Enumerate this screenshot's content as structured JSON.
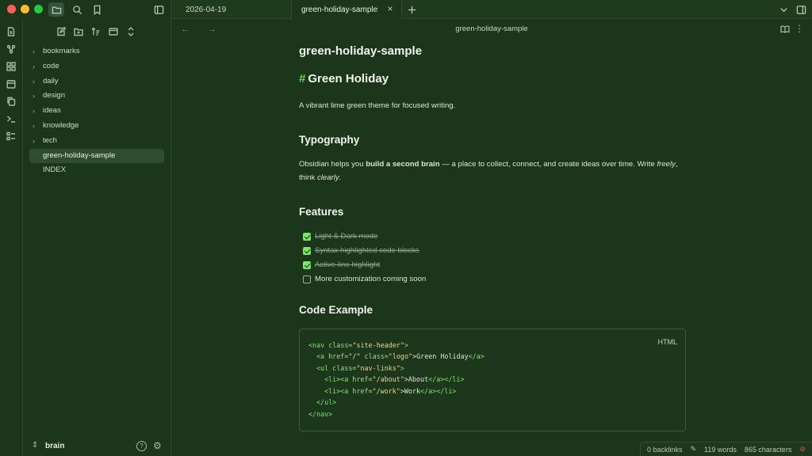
{
  "tabs": [
    {
      "label": "2026-04-19"
    },
    {
      "label": "green-holiday-sample",
      "active": true
    }
  ],
  "ribbon_icons": [
    "open-file-icon",
    "graph-icon",
    "grid-icon",
    "calendar-icon",
    "copy-icon",
    "terminal-icon",
    "list-icon"
  ],
  "sidebar": {
    "tree": [
      {
        "label": "bookmarks",
        "folder": true
      },
      {
        "label": "code",
        "folder": true
      },
      {
        "label": "daily",
        "folder": true
      },
      {
        "label": "design",
        "folder": true
      },
      {
        "label": "ideas",
        "folder": true
      },
      {
        "label": "knowledge",
        "folder": true
      },
      {
        "label": "tech",
        "folder": true
      },
      {
        "label": "green-holiday-sample",
        "folder": false,
        "selected": true
      },
      {
        "label": "INDEX",
        "folder": false
      }
    ],
    "vault_name": "brain",
    "help_label": "?"
  },
  "view": {
    "title": "green-holiday-sample",
    "back_forward": "← →"
  },
  "doc": {
    "title": "green-holiday-sample",
    "h1_hash": "#",
    "h1": "Green Holiday",
    "intro": "A vibrant lime green theme for focused writing.",
    "typography_heading": "Typography",
    "typo_p1_pre": "Obsidian helps you ",
    "typo_p1_bold": "build a second brain",
    "typo_p1_post": " — a place to collect, connect, and create ideas over time. Write ",
    "typo_p1_em1": "freely",
    "typo_p1_mid": ", think ",
    "typo_p1_em2": "clearly",
    "typo_p1_end": ".",
    "features_heading": "Features",
    "tasks": [
      {
        "text": "Light & Dark mode",
        "done": true
      },
      {
        "text": "Syntax highlighted code blocks",
        "done": true
      },
      {
        "text": "Active line highlight",
        "done": true
      },
      {
        "text": "More customization coming soon",
        "done": false
      }
    ],
    "code_heading": "Code Example",
    "code_lang": "HTML",
    "code": {
      "l1_tag": "<nav",
      "l1_attr": " class=",
      "l1_str": "\"site-header\"",
      "l1_close": ">",
      "l2_tag": "<a",
      "l2_attr1": " href=",
      "l2_str1": "\"/\"",
      "l2_attr2": " class=",
      "l2_str2": "\"logo\"",
      "l2_text": ">Green Holiday",
      "l2_end": "</a>",
      "l3_tag": "<ul",
      "l3_attr": " class=",
      "l3_str": "\"nav-links\"",
      "l3_close": ">",
      "l4_li": "<li><a",
      "l4_attr": " href=",
      "l4_str": "\"/about\"",
      "l4_text": ">About",
      "l4_end": "</a></li>",
      "l5_li": "<li><a",
      "l5_attr": " href=",
      "l5_str": "\"/work\"",
      "l5_text": ">Work",
      "l5_end": "</a></li>",
      "l6": "</ul>",
      "l7": "</nav>"
    }
  },
  "status": {
    "backlinks": "0 backlinks",
    "words": "119 words",
    "characters": "865 characters"
  },
  "colors": {
    "background": "#1c361c",
    "accent": "#7de46a",
    "heading_hash": "#6fcf5f"
  }
}
